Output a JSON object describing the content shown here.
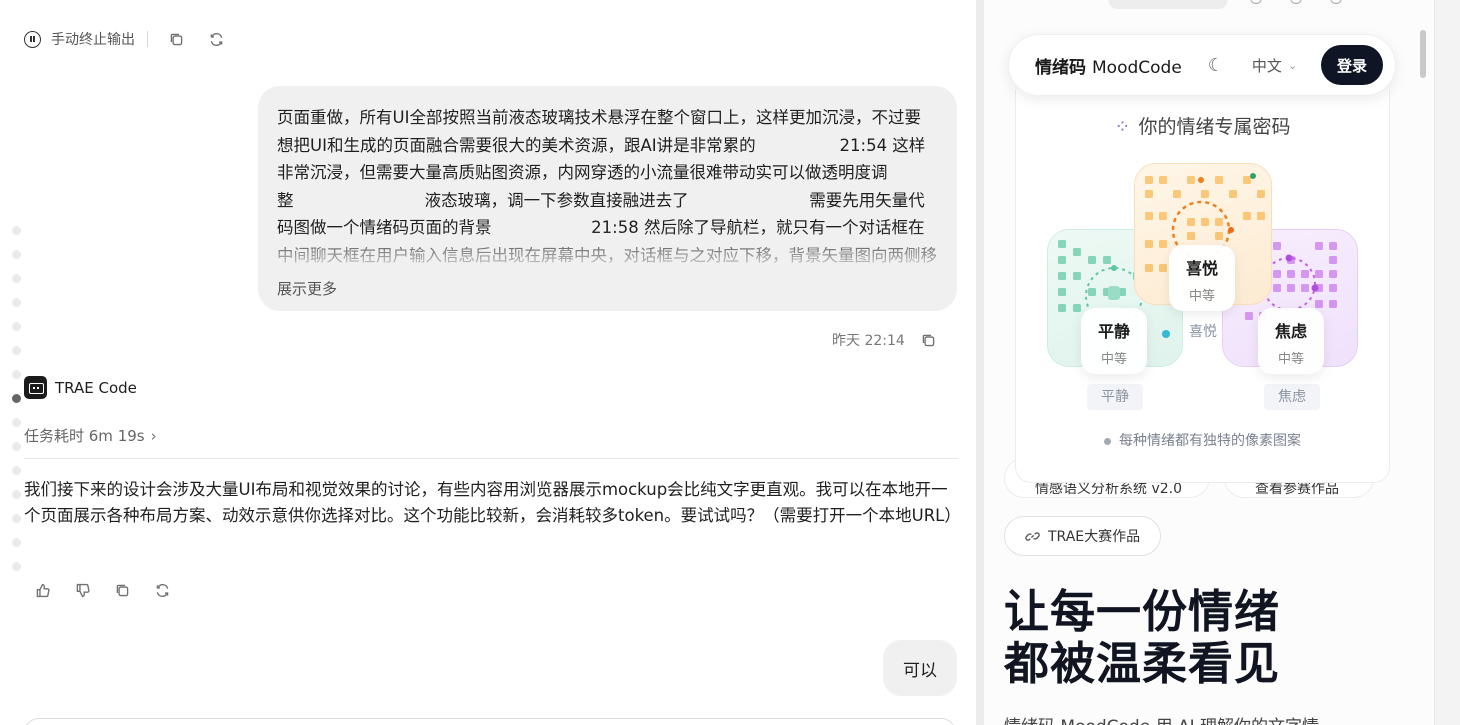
{
  "chat": {
    "stop_output_label": "手动终止输出",
    "user_message": "页面重做，所有UI全部按照当前液态玻璃技术悬浮在整个窗口上，这样更加沉浸，不过要想把UI和生成的页面融合需要很大的美术资源，跟AI讲是非常累的                21:54 这样非常沉浸，但需要大量高质贴图资源，内网穿透的小流量很难带动实可以做透明度调整                         液态玻璃，调一下参数直接融进去了                       需要先用矢量代码图做一个情绪码页面的背景                   21:58 然后除了导航栏，就只有一个对话框在中间聊天框在用户输入信息后出现在屏幕中央，对话框与之对应下移，背景矢量图向两侧移动空出",
    "show_more_label": "展示更多",
    "message_time": "昨天 22:14",
    "agent_name": "TRAE Code",
    "task_duration": "任务耗时 6m 19s",
    "assistant_reply": "我们接下来的设计会涉及大量UI布局和视觉效果的讨论，有些内容用浏览器展示mockup会比纯文字更直观。我可以在本地开一个页面展示各种布局方案、动效示意供你选择对比。这个功能比较新，会消耗较多token。要试试吗？（需要打开一个本地URL）",
    "user_reply": "可以"
  },
  "preview": {
    "nav": {
      "brand_cn": "情绪码",
      "brand_en": "MoodCode",
      "language": "中文",
      "login_label": "登录"
    },
    "card": {
      "title": "你的情绪专属密码",
      "moods": [
        {
          "name": "平静",
          "level": "中等",
          "caption": "平静",
          "color": "#5cc6a3"
        },
        {
          "name": "喜悦",
          "level": "中等",
          "caption": "喜悦",
          "color": "#f5a524"
        },
        {
          "name": "焦虑",
          "level": "中等",
          "caption": "焦虑",
          "color": "#c061e8"
        }
      ],
      "footer": "每种情绪都有独特的像素图案"
    },
    "chips": {
      "hidden_left": "情感语义分析系统 v2.0",
      "hidden_right": "查看参赛作品",
      "trae_entry": "TRAE大赛作品"
    },
    "hero": {
      "line1": "让每一份情绪",
      "line2": "都被温柔看见",
      "subtitle": "情绪码 MoodCode 用 AI 理解你的文字情"
    }
  }
}
